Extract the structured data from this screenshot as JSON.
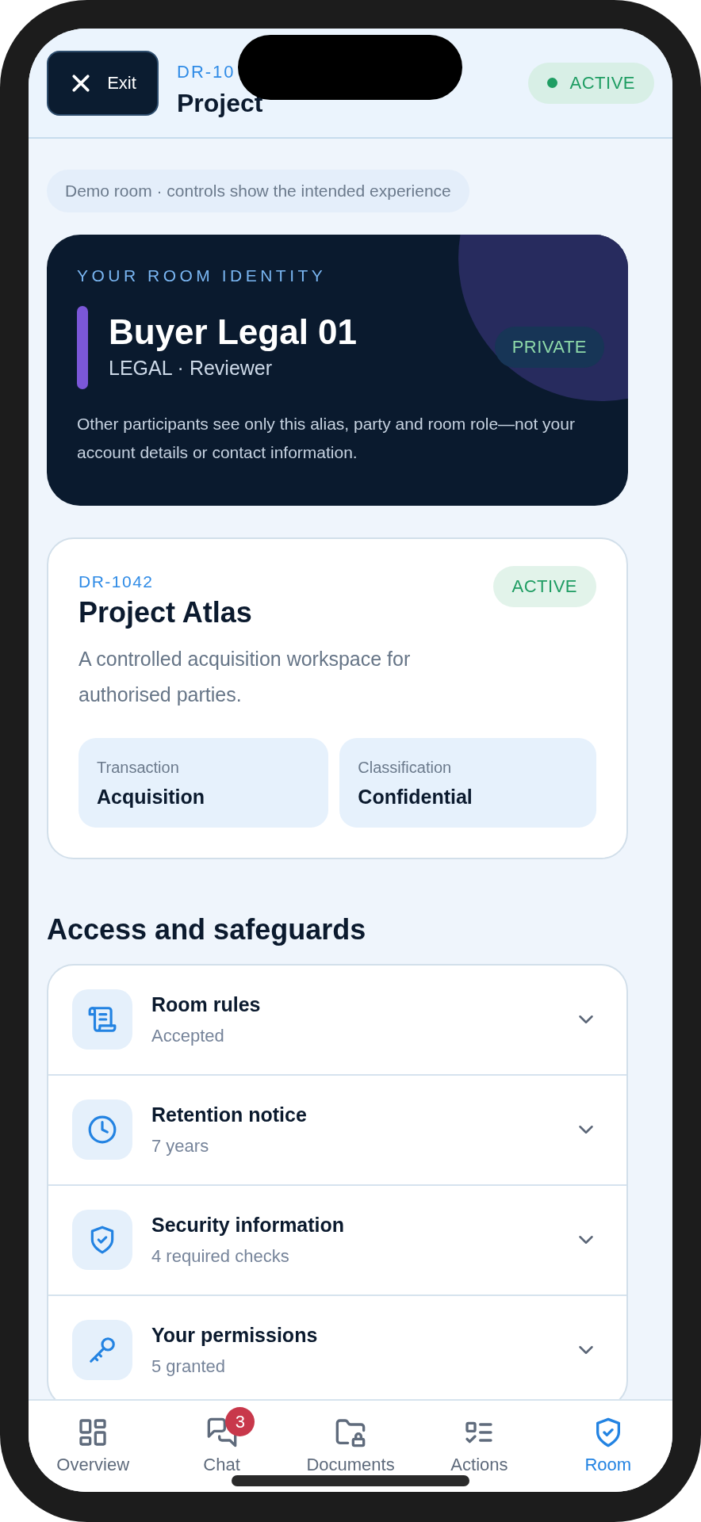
{
  "header": {
    "exit_button": "Exit",
    "room_id": "DR-10",
    "title": "Project",
    "status": "ACTIVE"
  },
  "notice": "Demo room · controls show the intended experience",
  "identity": {
    "eyebrow": "YOUR ROOM IDENTITY",
    "alias": "Buyer Legal 01",
    "role": "LEGAL · Reviewer",
    "badge": "PRIVATE",
    "note": "Other participants see only this alias, party and room role—not your account details or contact information."
  },
  "room": {
    "id": "DR-1042",
    "title": "Project Atlas",
    "status": "ACTIVE",
    "description": "A controlled acquisition workspace for authorised parties.",
    "facts": [
      {
        "label": "Transaction",
        "value": "Acquisition"
      },
      {
        "label": "Classification",
        "value": "Confidential"
      }
    ]
  },
  "safeguards": {
    "heading": "Access and safeguards",
    "items": [
      {
        "kind": "rules",
        "title": "Room rules",
        "detail": "Accepted",
        "expanded": false
      },
      {
        "kind": "retention",
        "title": "Retention notice",
        "detail": "7 years",
        "expanded": false
      },
      {
        "kind": "security",
        "title": "Security information",
        "detail": "4 required checks",
        "expanded": false
      },
      {
        "kind": "permissions",
        "title": "Your permissions",
        "detail": "5 granted",
        "expanded": false
      }
    ]
  },
  "tabs": [
    {
      "kind": "overview",
      "label": "Overview",
      "selected": false
    },
    {
      "kind": "chat",
      "label": "Chat",
      "badge": "3",
      "selected": false
    },
    {
      "kind": "documents",
      "label": "Documents",
      "selected": false
    },
    {
      "kind": "actions",
      "label": "Actions",
      "selected": false
    },
    {
      "kind": "room",
      "label": "Room",
      "selected": true
    }
  ]
}
